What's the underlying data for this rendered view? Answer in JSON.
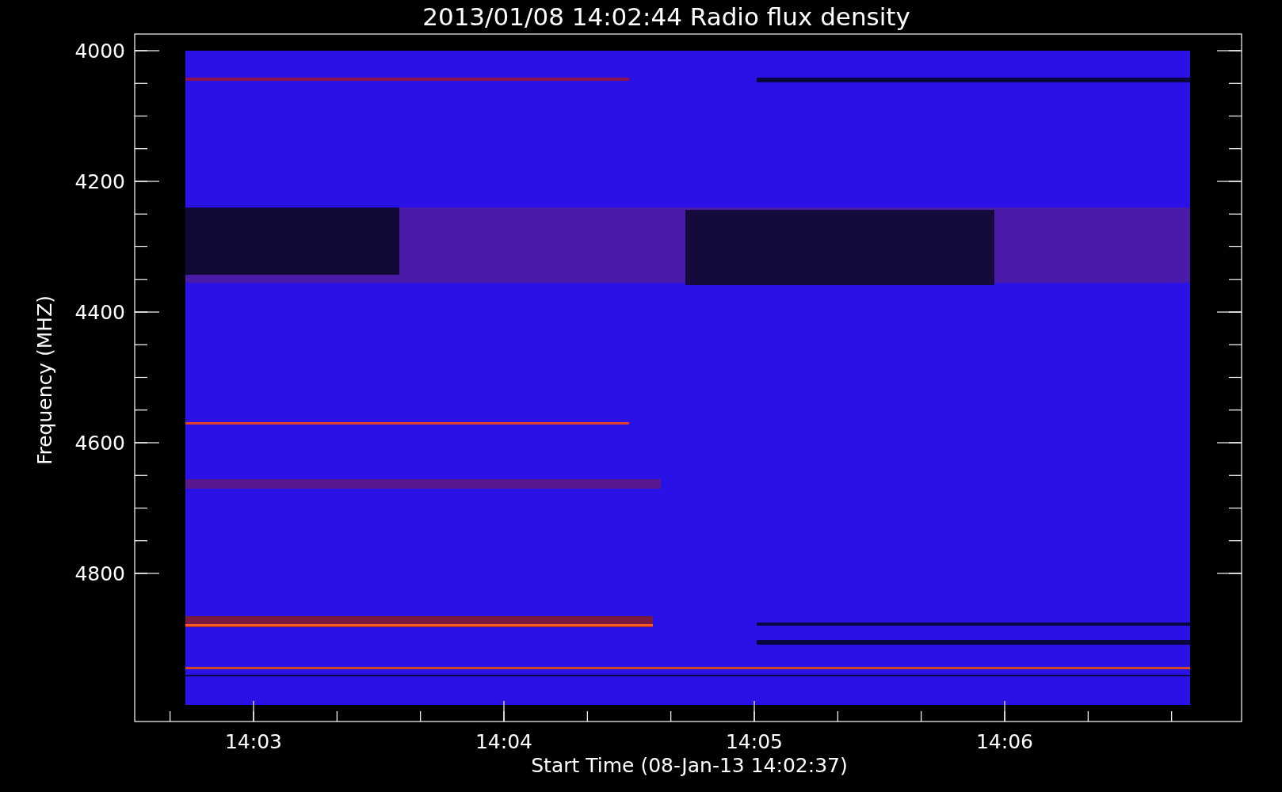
{
  "title": "2013/01/08 14:02:44 Radio flux density",
  "y_axis": {
    "label": "Frequency (MHZ)",
    "ticks": [
      "4000",
      "4200",
      "4400",
      "4600",
      "4800"
    ]
  },
  "x_axis": {
    "label": "Start Time (08-Jan-13 14:02:37)",
    "ticks": [
      "14:03",
      "14:04",
      "14:05",
      "14:06"
    ]
  }
}
